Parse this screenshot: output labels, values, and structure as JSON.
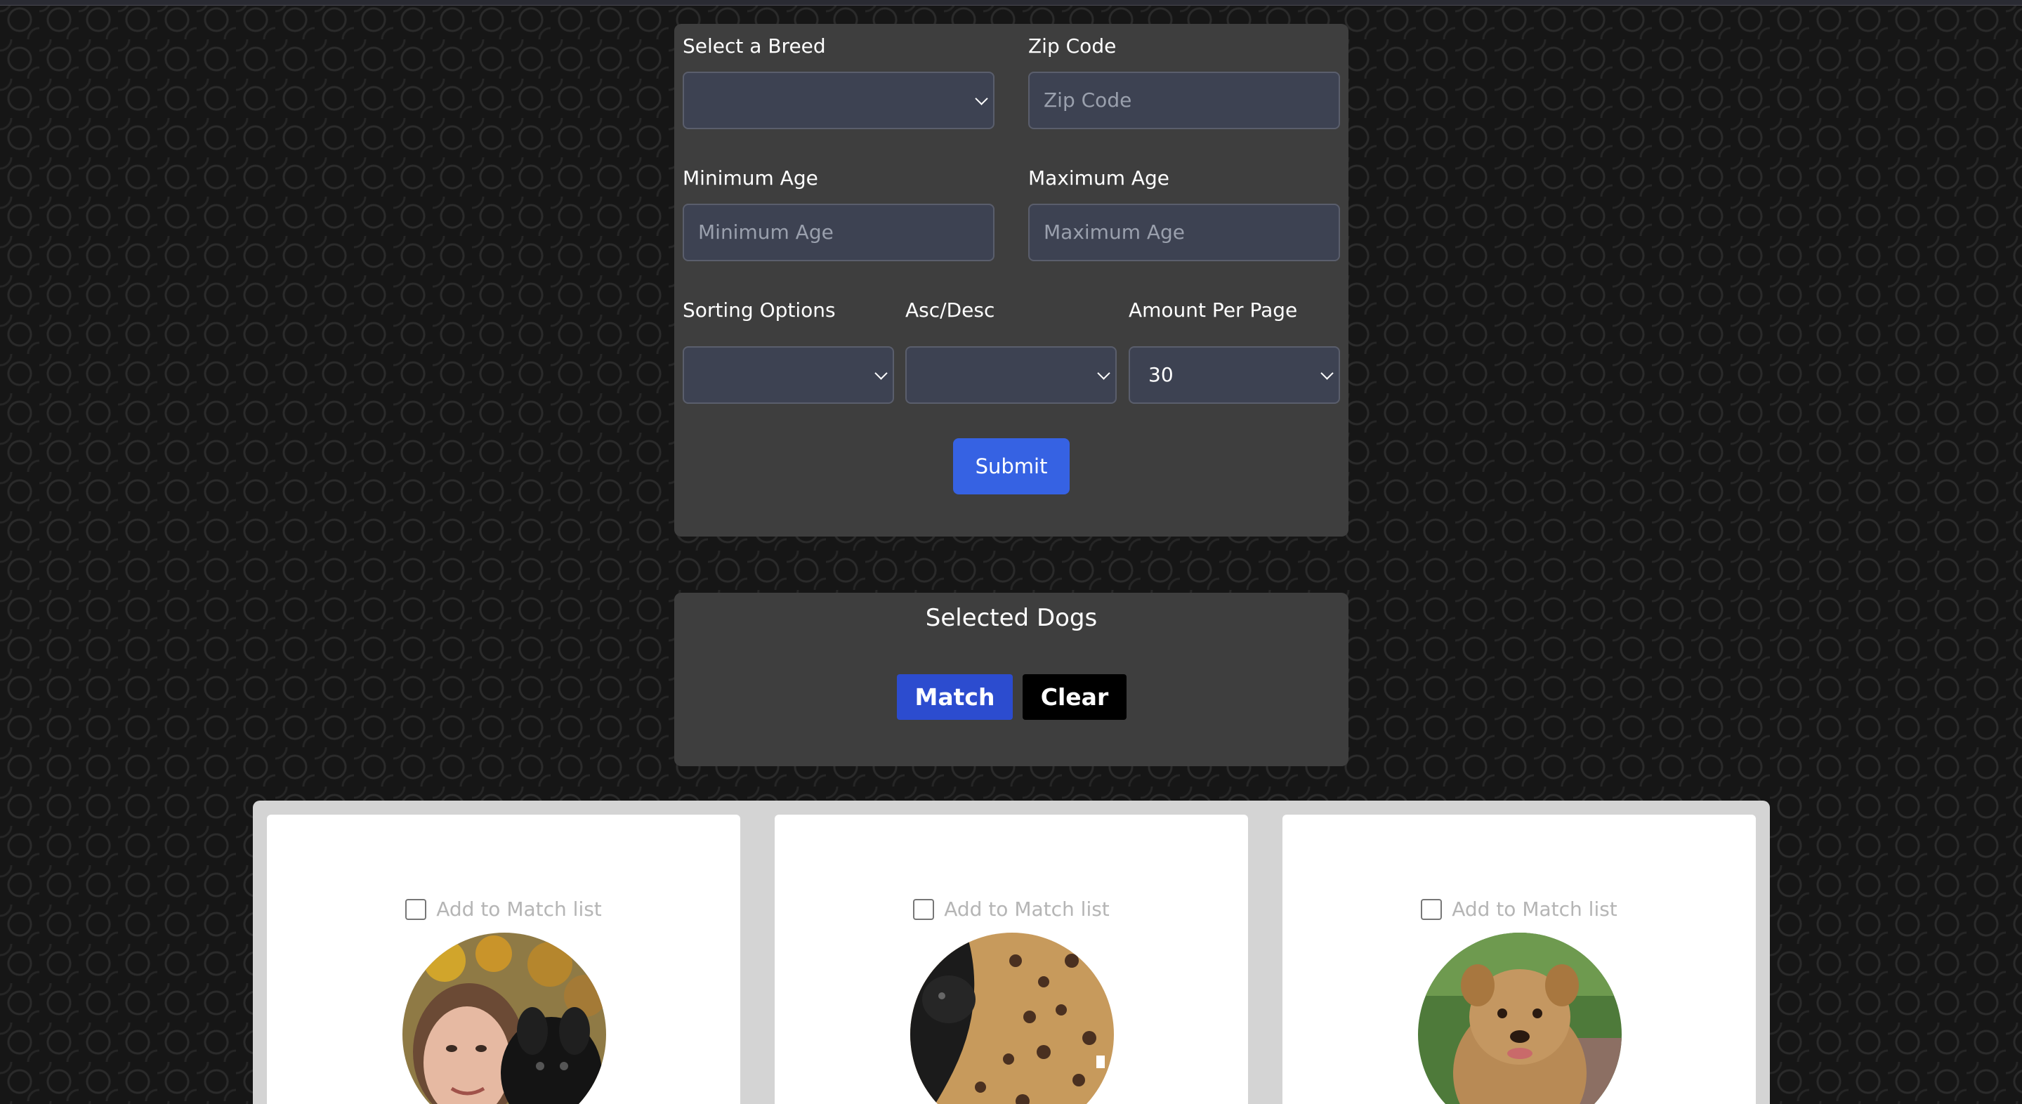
{
  "search_form": {
    "breed_label": "Select a Breed",
    "breed_value": "",
    "zip_label": "Zip Code",
    "zip_placeholder": "Zip Code",
    "min_age_label": "Minimum Age",
    "min_age_placeholder": "Minimum Age",
    "max_age_label": "Maximum Age",
    "max_age_placeholder": "Maximum Age",
    "sort_label": "Sorting Options",
    "sort_value": "",
    "order_label": "Asc/Desc",
    "order_value": "",
    "per_page_label": "Amount Per Page",
    "per_page_value": "30",
    "submit_label": "Submit"
  },
  "selected_dogs": {
    "title": "Selected Dogs",
    "match_label": "Match",
    "clear_label": "Clear"
  },
  "results": {
    "cards": [
      {
        "match_label": "Add to Match list",
        "checked": false
      },
      {
        "match_label": "Add to Match list",
        "checked": false
      },
      {
        "match_label": "Add to Match list",
        "checked": false
      }
    ]
  },
  "colors": {
    "panel": "#3e3e3e",
    "input_bg": "#3d4252",
    "submit": "#3662e3",
    "match": "#2c4ccf",
    "clear": "#000000"
  }
}
